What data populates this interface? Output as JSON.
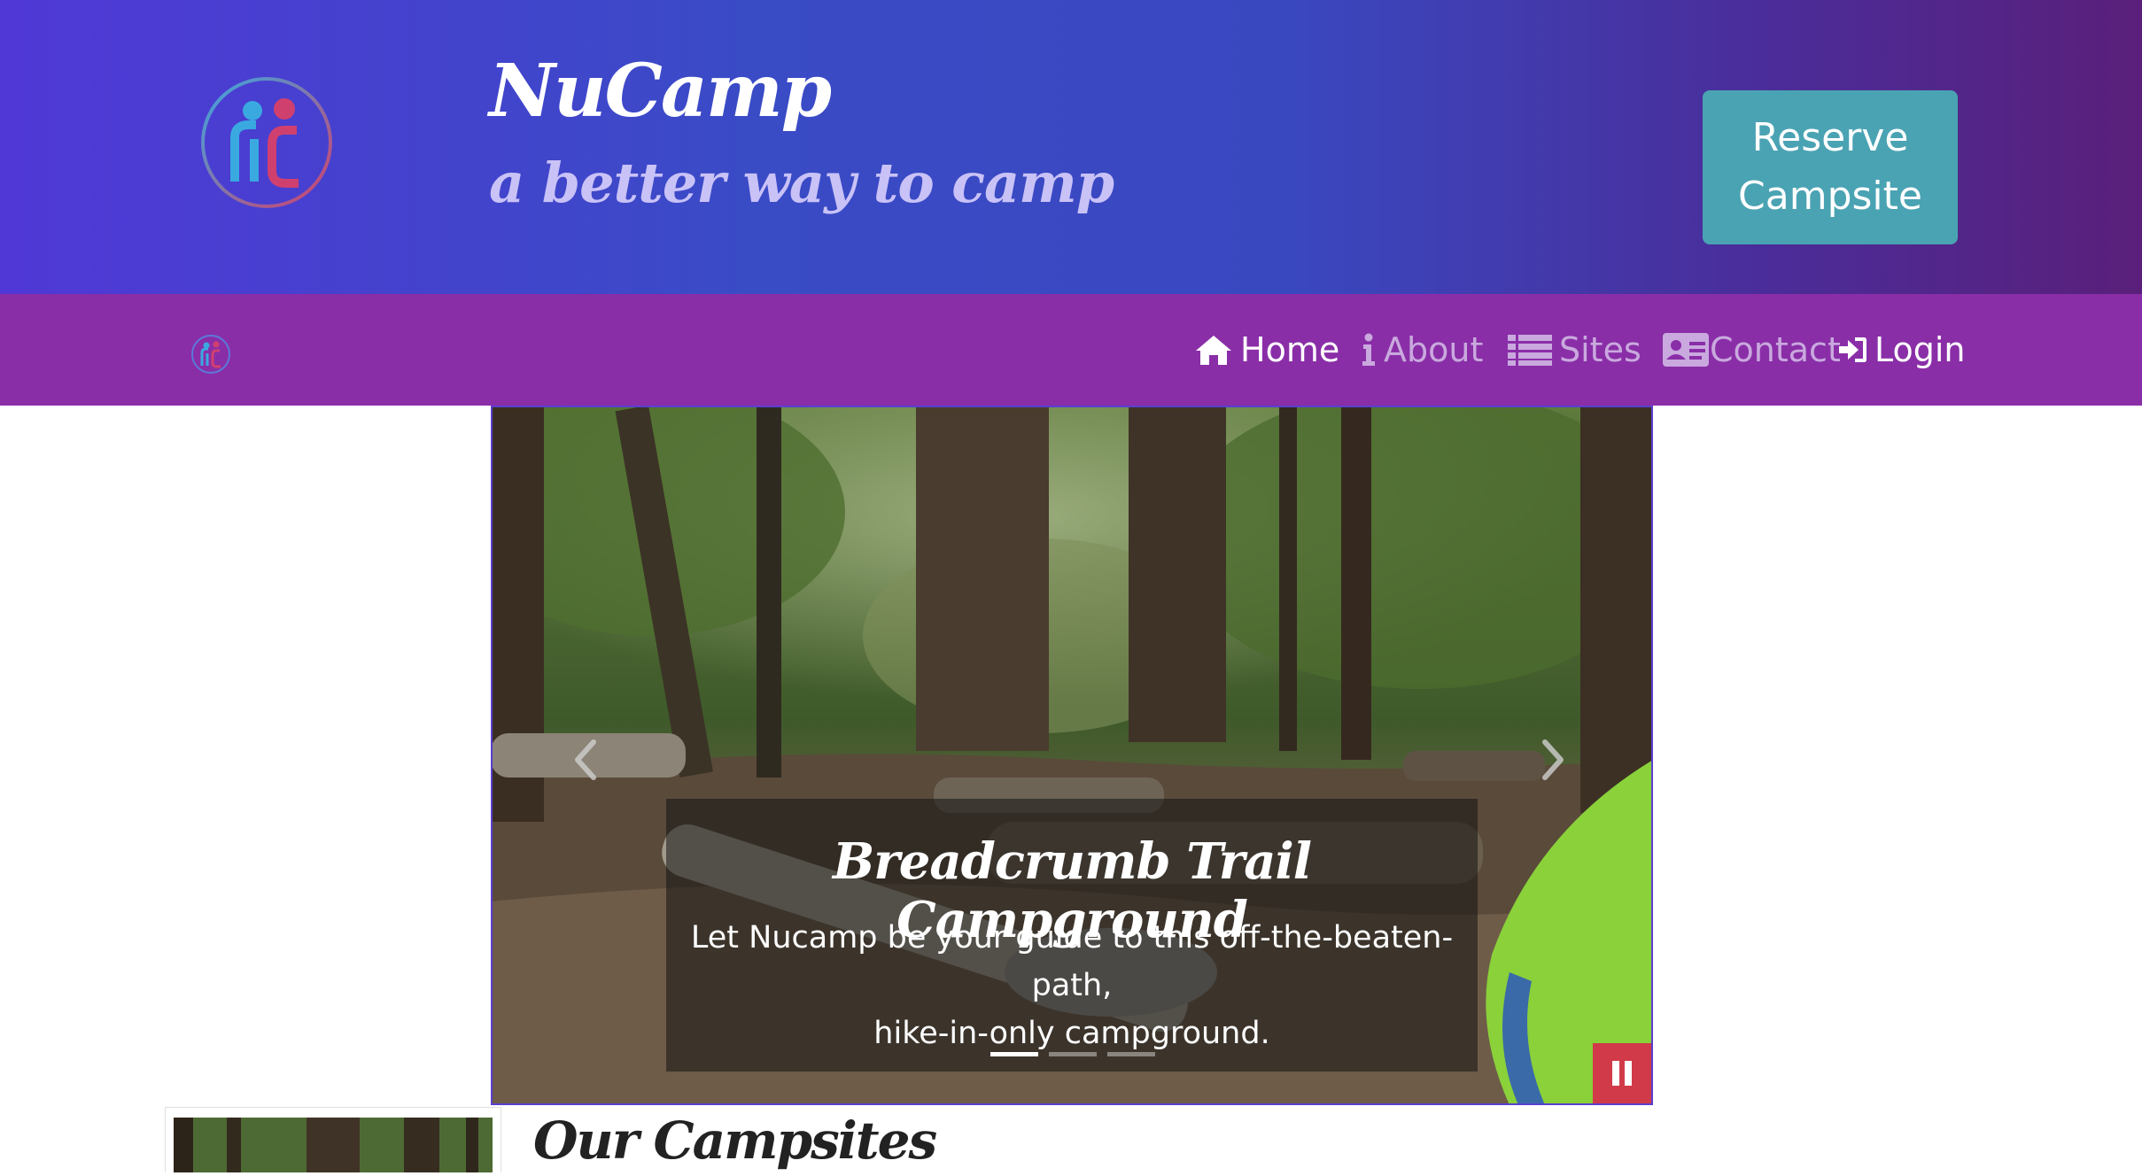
{
  "header": {
    "brand_title": "NuCamp",
    "tagline": "a better way to camp",
    "reserve_line1": "Reserve",
    "reserve_line2": "Campsite"
  },
  "nav": {
    "items": [
      {
        "label": "Home",
        "icon": "home-icon",
        "active": true
      },
      {
        "label": "About",
        "icon": "info-icon",
        "active": false
      },
      {
        "label": "Sites",
        "icon": "list-icon",
        "active": false
      },
      {
        "label": "Contact",
        "icon": "address-card-icon",
        "active": false
      },
      {
        "label": "Login",
        "icon": "sign-in-icon",
        "active": true
      }
    ]
  },
  "carousel": {
    "caption_title": "Breadcrumb Trail Campground",
    "caption_line1": "Let Nucamp be your guide to this off-the-beaten-path,",
    "caption_line2": "hike-in-only campground.",
    "slide_count": 3,
    "active_slide": 1
  },
  "section": {
    "title": "Our Campsites"
  },
  "colors": {
    "header_start": "#5038d6",
    "header_end": "#5a1f7a",
    "navbar": "#8a2ea8",
    "reserve_button": "#4aa3b3",
    "pause_button": "#d13a48"
  }
}
